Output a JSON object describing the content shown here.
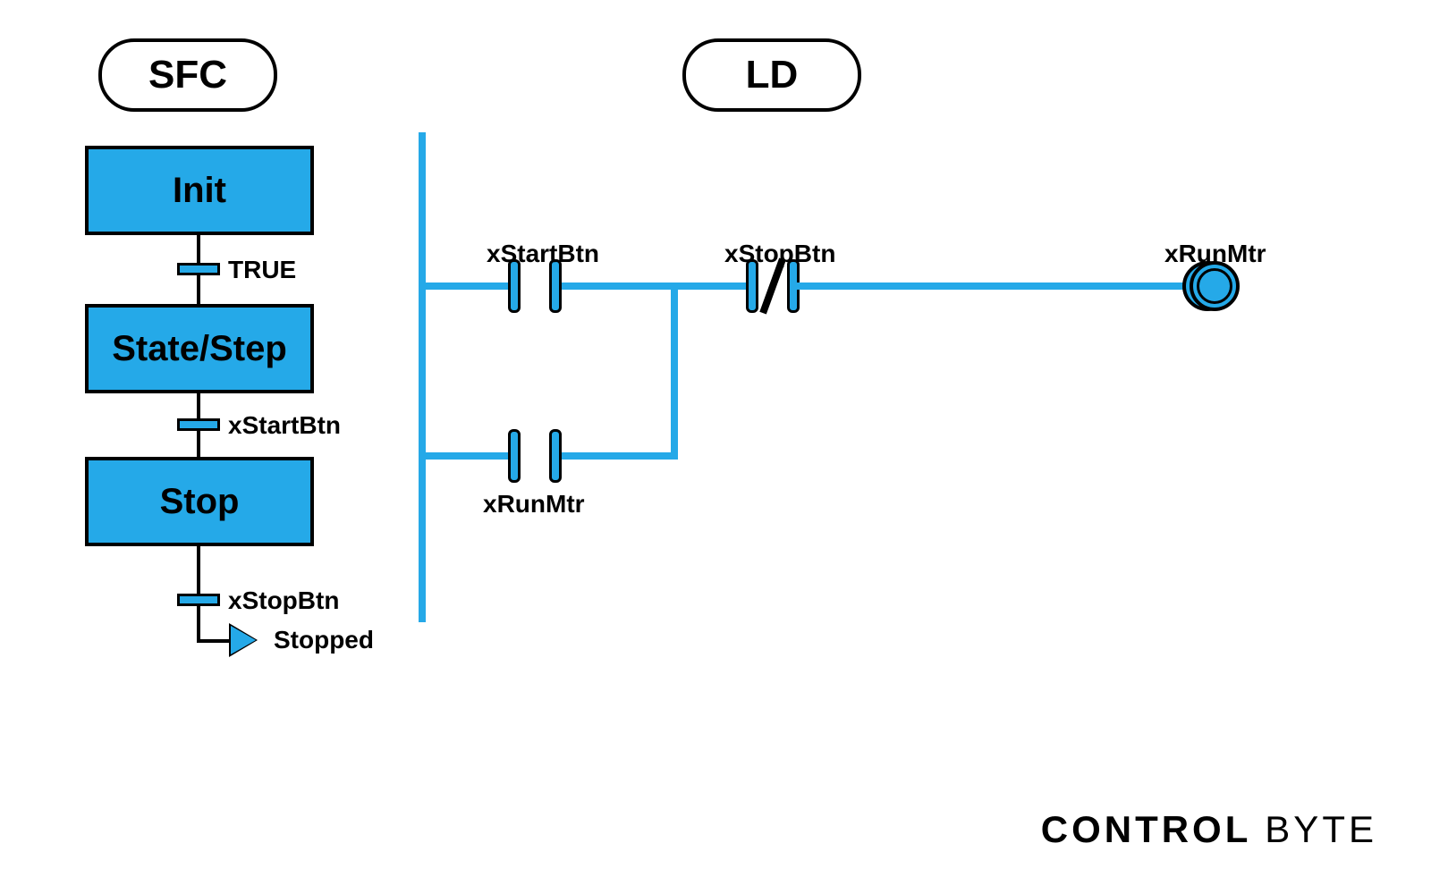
{
  "headers": {
    "sfc": "SFC",
    "ld": "LD"
  },
  "sfc": {
    "steps": {
      "init": "Init",
      "mid": "State/Step",
      "stop": "Stop"
    },
    "trans": {
      "t1": "TRUE",
      "t2": "xStartBtn",
      "t3": "xStopBtn"
    },
    "end": "Stopped"
  },
  "ld": {
    "labels": {
      "start": "xStartBtn",
      "stop": "xStopBtn",
      "latch": "xRunMtr",
      "coil": "xRunMtr"
    }
  },
  "footer": {
    "brand": "CONTROL",
    "brand2": "byTe"
  }
}
